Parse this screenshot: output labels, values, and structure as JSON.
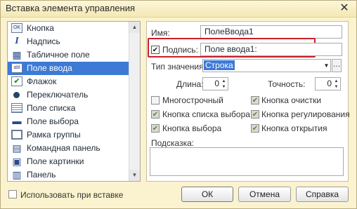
{
  "window": {
    "title": "Вставка элемента управления",
    "close_glyph": "✕"
  },
  "list": {
    "items": [
      {
        "label": "Кнопка",
        "icon": "button-icon",
        "glyph": "OK"
      },
      {
        "label": "Надпись",
        "icon": "label-icon",
        "glyph": "I"
      },
      {
        "label": "Табличное поле",
        "icon": "table-icon",
        "glyph": "▦"
      },
      {
        "label": "Поле ввода",
        "icon": "input-field-icon",
        "glyph": "abl",
        "selected": true
      },
      {
        "label": "Флажок",
        "icon": "checkbox-icon",
        "glyph": "✔"
      },
      {
        "label": "Переключатель",
        "icon": "radio-icon",
        "glyph": ""
      },
      {
        "label": "Поле списка",
        "icon": "list-field-icon",
        "glyph": ""
      },
      {
        "label": "Поле выбора",
        "icon": "combo-field-icon",
        "glyph": "▬"
      },
      {
        "label": "Рамка группы",
        "icon": "group-frame-icon",
        "glyph": ""
      },
      {
        "label": "Командная панель",
        "icon": "command-bar-icon",
        "glyph": "▤"
      },
      {
        "label": "Поле картинки",
        "icon": "picture-field-icon",
        "glyph": "▣"
      },
      {
        "label": "Панель",
        "icon": "panel-icon",
        "glyph": "▥"
      }
    ]
  },
  "form": {
    "name_label": "Имя:",
    "name_value": "ПолеВвода1",
    "caption_label": "Подпись:",
    "caption_checked": true,
    "caption_value": "Поле ввода1:",
    "type_label": "Тип значения:",
    "type_value": "Строка",
    "length_label": "Длина:",
    "length_value": "0",
    "precision_label": "Точность:",
    "precision_value": "0",
    "options_left": [
      {
        "label": "Многострочный",
        "checked": false
      },
      {
        "label": "Кнопка списка выбора",
        "checked": true
      },
      {
        "label": "Кнопка выбора",
        "checked": true
      }
    ],
    "options_right": [
      {
        "label": "Кнопка очистки",
        "checked": true
      },
      {
        "label": "Кнопка регулирования",
        "checked": true
      },
      {
        "label": "Кнопка открытия",
        "checked": true
      }
    ],
    "hint_label": "Подсказка:",
    "hint_value": ""
  },
  "footer": {
    "use_on_insert_label": "Использовать при вставке",
    "use_on_insert_checked": false,
    "ok_label": "ОК",
    "cancel_label": "Отмена",
    "help_label": "Справка"
  },
  "colors": {
    "selection": "#3d7ad6",
    "highlight_border": "#c8202a",
    "window_bg": "#fbf3cf"
  }
}
